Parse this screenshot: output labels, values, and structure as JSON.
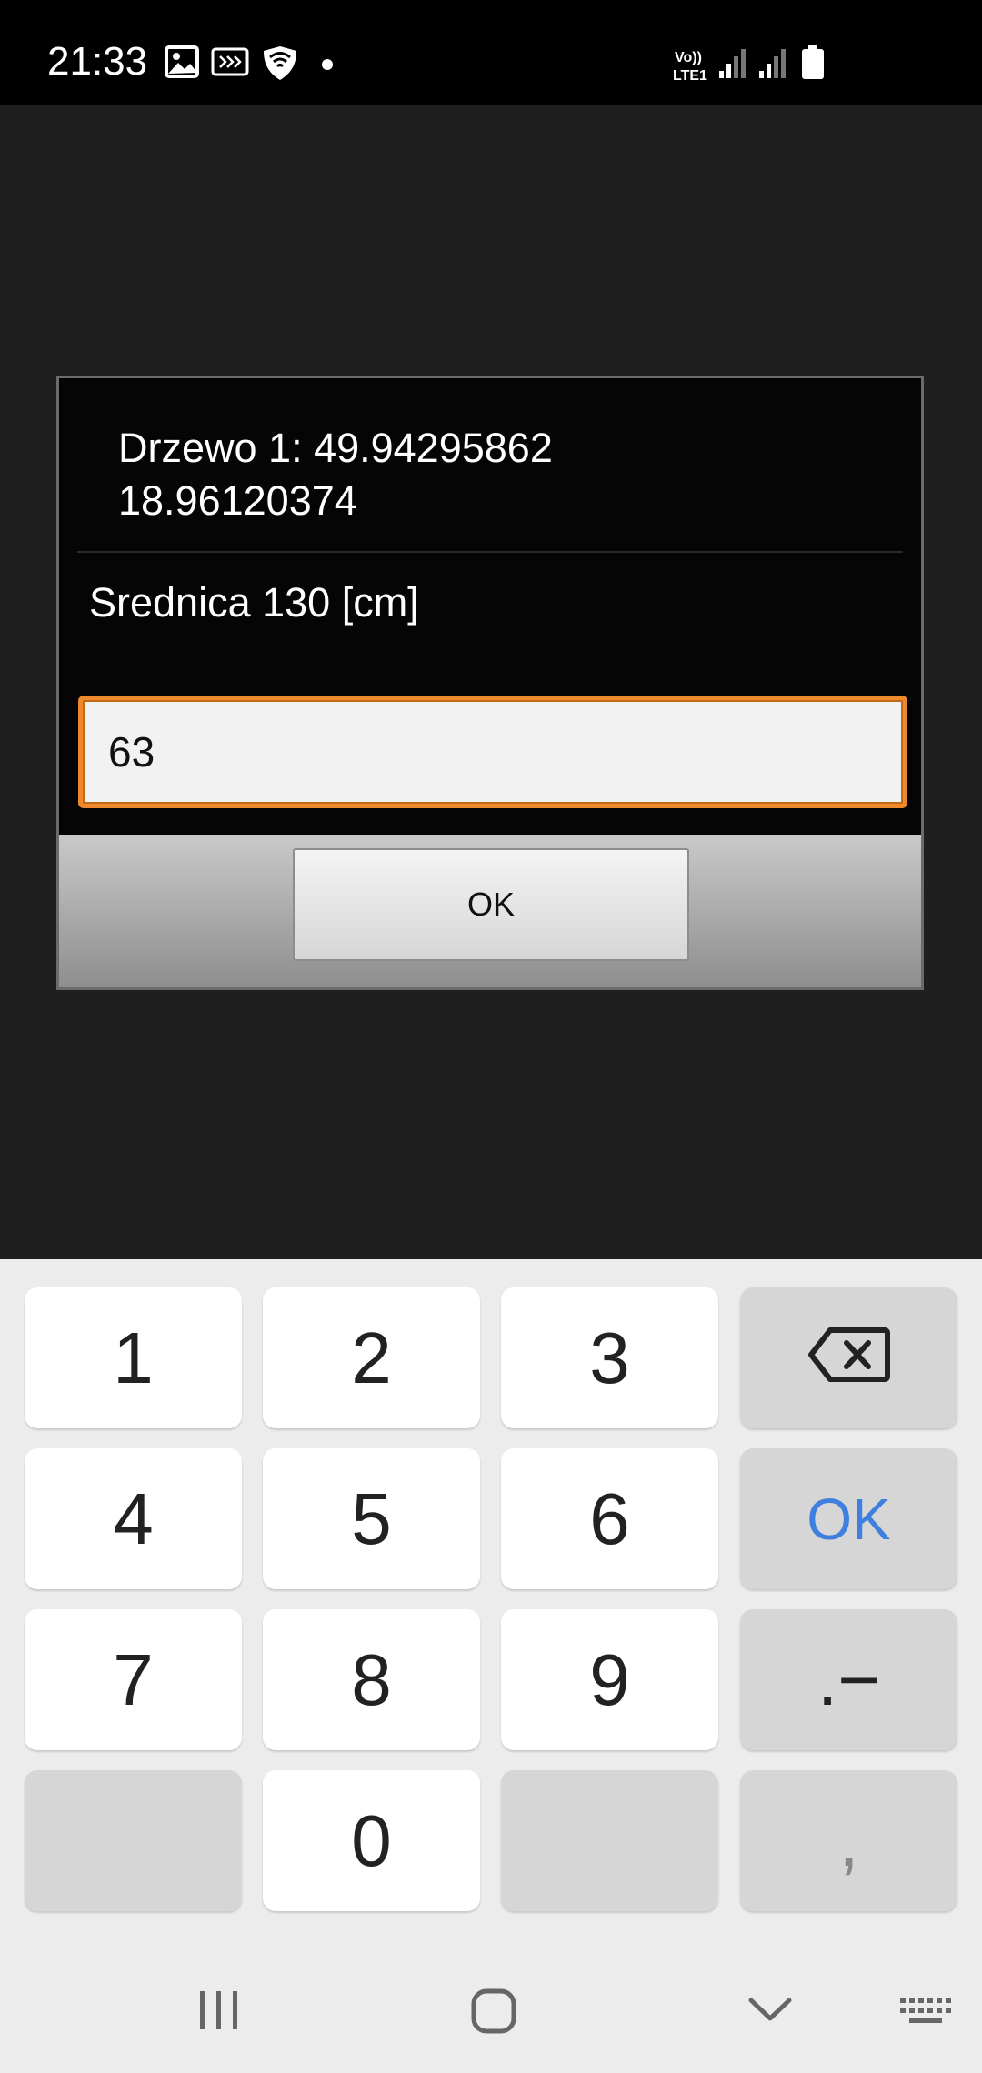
{
  "status_bar": {
    "time": "21:33",
    "notification_icons": [
      "image-icon",
      "cast-icon",
      "shield-wifi-icon",
      "dot-icon"
    ],
    "network_label_top": "Vo))",
    "network_label_bottom": "LTE1",
    "right_icons": [
      "signal-1-icon",
      "signal-2-icon",
      "battery-icon"
    ]
  },
  "dialog": {
    "title_line1": "Drzewo 1: 49.94295862",
    "title_line2": "18.96120374",
    "label": "Srednica 130 [cm]",
    "input_value": "63",
    "ok_label": "OK",
    "input_border_color": "#ee8a2c"
  },
  "keyboard": {
    "rows": [
      [
        "1",
        "2",
        "3",
        "⌫"
      ],
      [
        "4",
        "5",
        "6",
        "OK"
      ],
      [
        "7",
        "8",
        "9",
        ".−"
      ],
      [
        "",
        "0",
        "",
        ","
      ]
    ],
    "ok_label": "OK",
    "ok_color": "#3f7fe0"
  },
  "nav_bar": {
    "buttons": [
      "recents-icon",
      "home-icon",
      "back-chevron-icon",
      "keyboard-icon"
    ]
  }
}
